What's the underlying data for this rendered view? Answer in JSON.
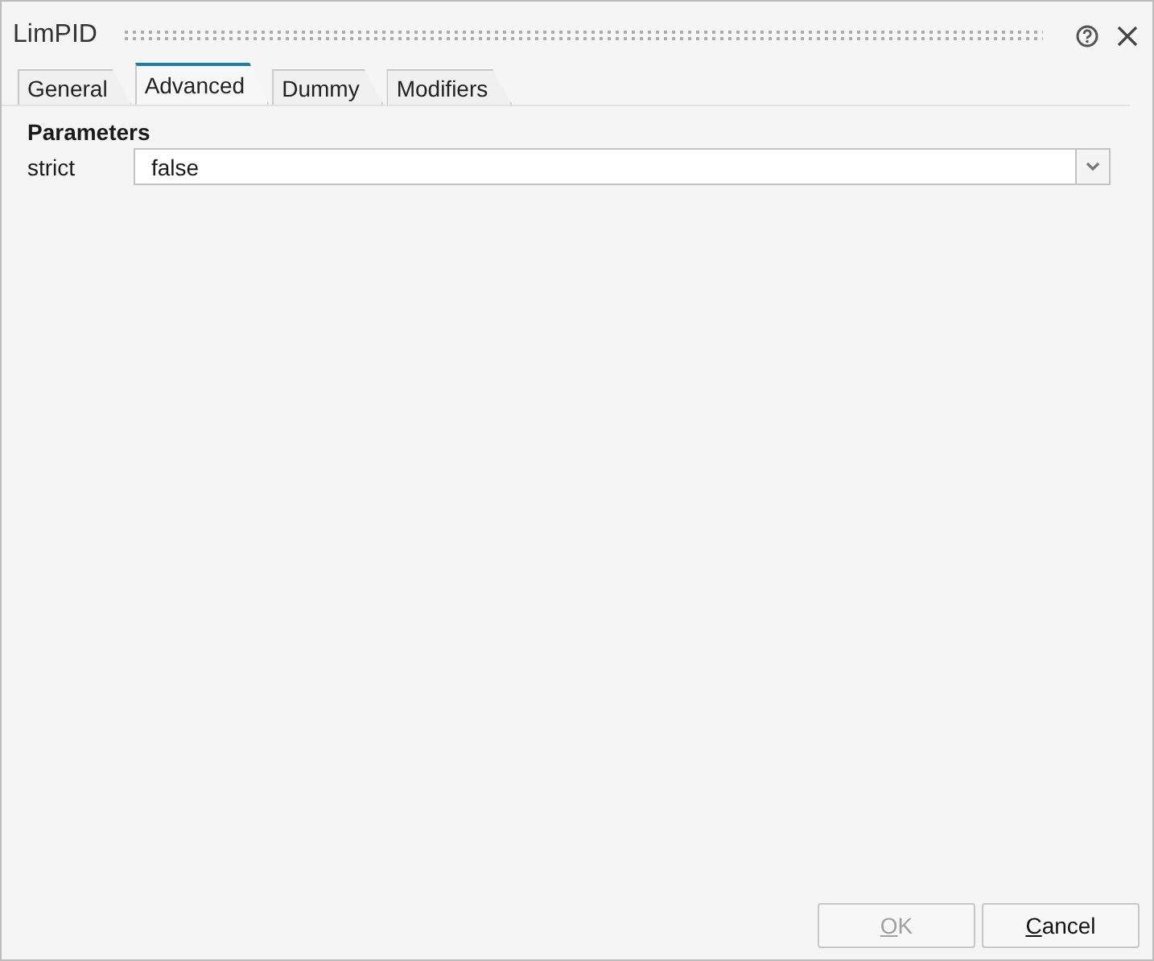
{
  "window": {
    "title": "LimPID"
  },
  "tabs": [
    {
      "label": "General",
      "selected": false
    },
    {
      "label": "Advanced",
      "selected": true
    },
    {
      "label": "Dummy",
      "selected": false
    },
    {
      "label": "Modifiers",
      "selected": false
    }
  ],
  "section": {
    "title": "Parameters"
  },
  "fields": [
    {
      "label": "strict",
      "value": "false"
    }
  ],
  "buttons": [
    {
      "label": "OK",
      "disabled": true
    },
    {
      "label": "Cancel",
      "disabled": false
    }
  ]
}
